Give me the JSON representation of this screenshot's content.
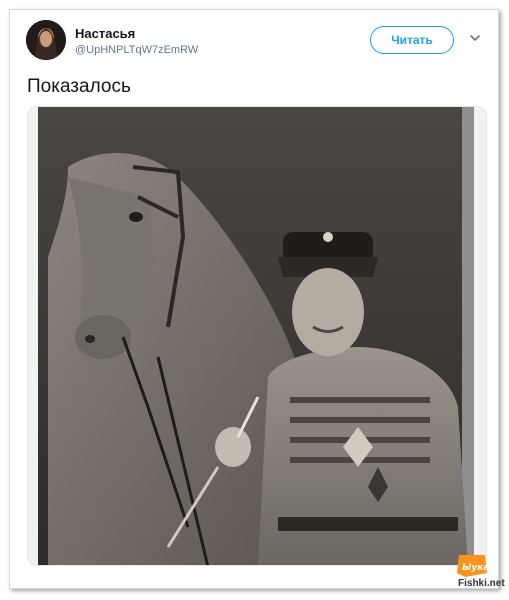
{
  "tweet": {
    "display_name": "Настасья",
    "handle": "@UpHNPLTqW7zEmRW",
    "follow_label": "Читать",
    "text": "Показалось",
    "menu_icon": "chevron-down-icon"
  },
  "media": {
    "description_icon": "photo",
    "tone": "sepia"
  },
  "watermark": {
    "logo_text": "Ыука",
    "site": "Fishki.net"
  },
  "colors": {
    "accent": "#1da1f2",
    "text": "#14171a",
    "muted": "#657786",
    "watermark_orange": "#f7941d"
  }
}
